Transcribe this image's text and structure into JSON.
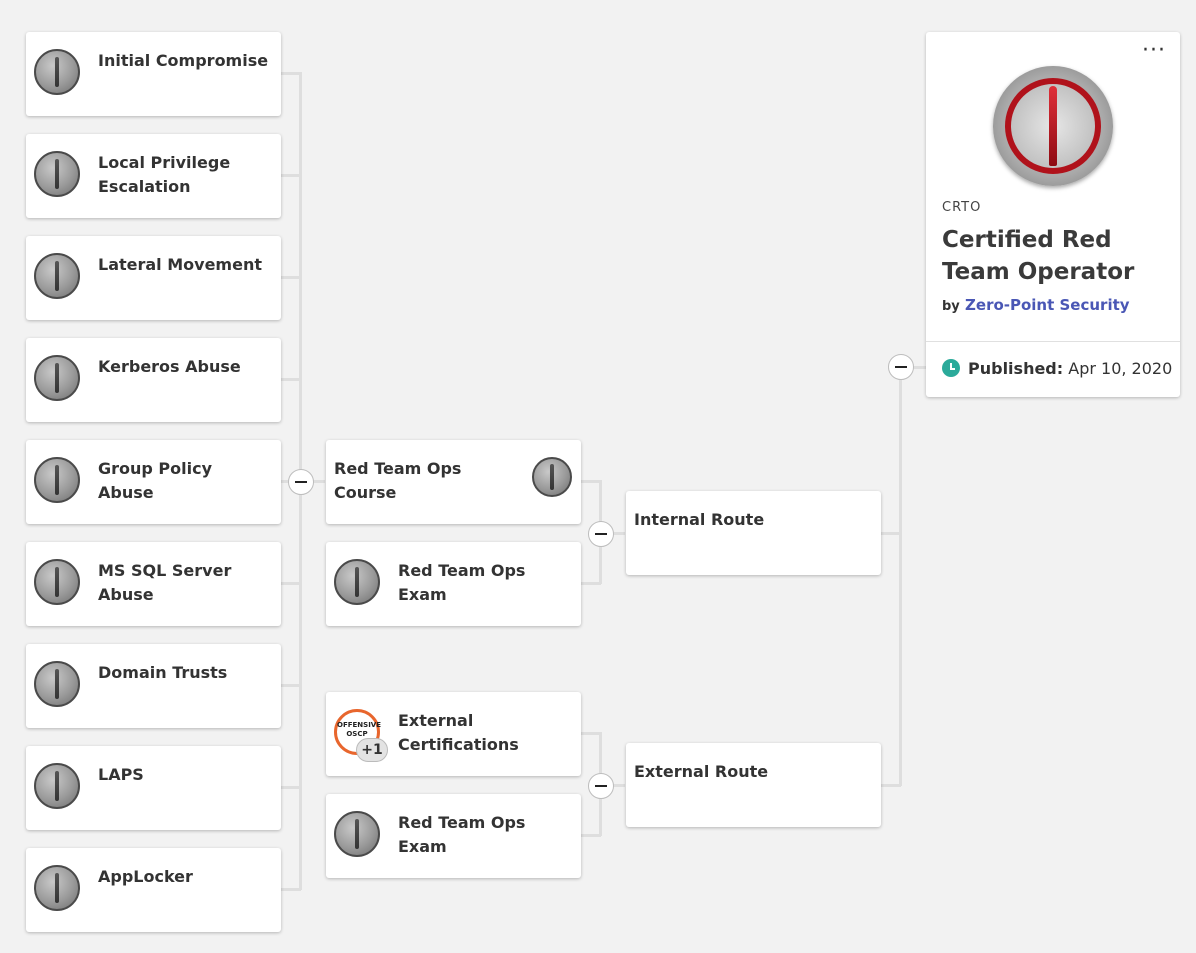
{
  "modules": [
    {
      "label": "Initial Compromise"
    },
    {
      "label": "Local Privilege Escalation"
    },
    {
      "label": "Lateral Movement"
    },
    {
      "label": "Kerberos Abuse"
    },
    {
      "label": "Group Policy Abuse"
    },
    {
      "label": "MS SQL Server Abuse"
    },
    {
      "label": "Domain Trusts"
    },
    {
      "label": "LAPS"
    },
    {
      "label": "AppLocker"
    }
  ],
  "course": {
    "label": "Red Team Ops Course"
  },
  "internal_exam": {
    "label": "Red Team Ops Exam"
  },
  "external_certs": {
    "label": "External Certifications",
    "badge_text": "OFFENSIVE OSCP",
    "extra_count": "+1"
  },
  "external_exam": {
    "label": "Red Team Ops Exam"
  },
  "internal_route": {
    "label": "Internal Route"
  },
  "external_route": {
    "label": "External Route"
  },
  "certification": {
    "code": "CRTO",
    "name": "Certified Red Team Operator",
    "by_label": "by",
    "issuer": "Zero-Point Security",
    "published_label": "Published:",
    "published_date": "Apr 10, 2020",
    "menu_glyph": "···"
  },
  "colors": {
    "accent_link": "#4a57b5",
    "clock": "#2baa9a",
    "medal_red": "#b0121b",
    "oscp_orange": "#e8662d"
  }
}
